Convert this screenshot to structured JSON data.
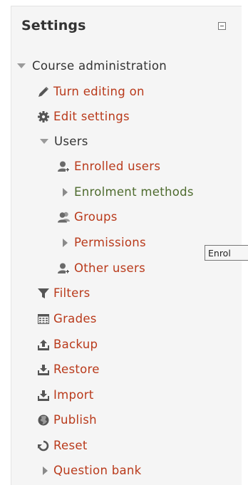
{
  "block": {
    "title": "Settings",
    "collapse_label": "−"
  },
  "tree": {
    "course_admin": "Course administration",
    "turn_editing": "Turn editing on",
    "edit_settings": "Edit settings",
    "users": "Users",
    "enrolled_users": "Enrolled users",
    "enrolment_methods": "Enrolment methods",
    "groups": "Groups",
    "permissions": "Permissions",
    "other_users": "Other users",
    "filters": "Filters",
    "grades": "Grades",
    "backup": "Backup",
    "restore": "Restore",
    "import": "Import",
    "publish": "Publish",
    "reset": "Reset",
    "question_bank": "Question bank"
  },
  "tooltip": {
    "text": "Enrol"
  },
  "colors": {
    "link": "#b93a1b",
    "text": "#333333",
    "icon": "#555555",
    "link_green": "#4e6b2e"
  }
}
